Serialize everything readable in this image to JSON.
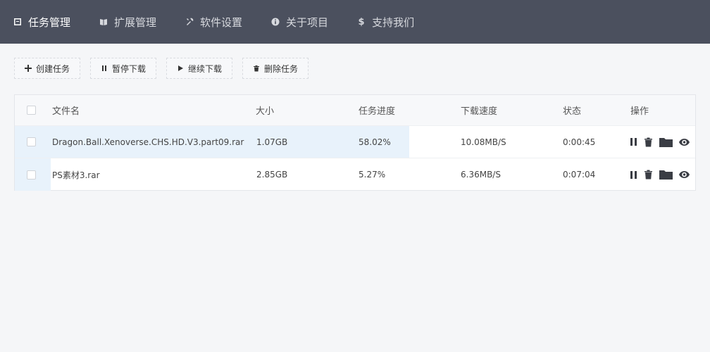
{
  "nav": [
    {
      "label": "任务管理",
      "icon": "task-icon"
    },
    {
      "label": "扩展管理",
      "icon": "book-icon"
    },
    {
      "label": "软件设置",
      "icon": "tools-icon"
    },
    {
      "label": "关于项目",
      "icon": "info-icon"
    },
    {
      "label": "支持我们",
      "icon": "dollar-icon"
    }
  ],
  "toolbar": {
    "create": "创建任务",
    "pause": "暂停下载",
    "resume": "继续下载",
    "delete": "删除任务"
  },
  "table": {
    "headers": {
      "name": "文件名",
      "size": "大小",
      "progress": "任务进度",
      "speed": "下载速度",
      "status": "状态",
      "actions": "操作"
    },
    "rows": [
      {
        "name": "Dragon.Ball.Xenoverse.CHS.HD.V3.part09.rar",
        "size": "1.07GB",
        "progress": "58.02%",
        "progress_value": 0.5802,
        "speed": "10.08MB/S",
        "status": "0:00:45"
      },
      {
        "name": "PS素材3.rar",
        "size": "2.85GB",
        "progress": "5.27%",
        "progress_value": 0.0527,
        "speed": "6.36MB/S",
        "status": "0:07:04"
      }
    ]
  },
  "colors": {
    "nav_bg": "#4b505e",
    "progress": "#e8f2fb"
  }
}
